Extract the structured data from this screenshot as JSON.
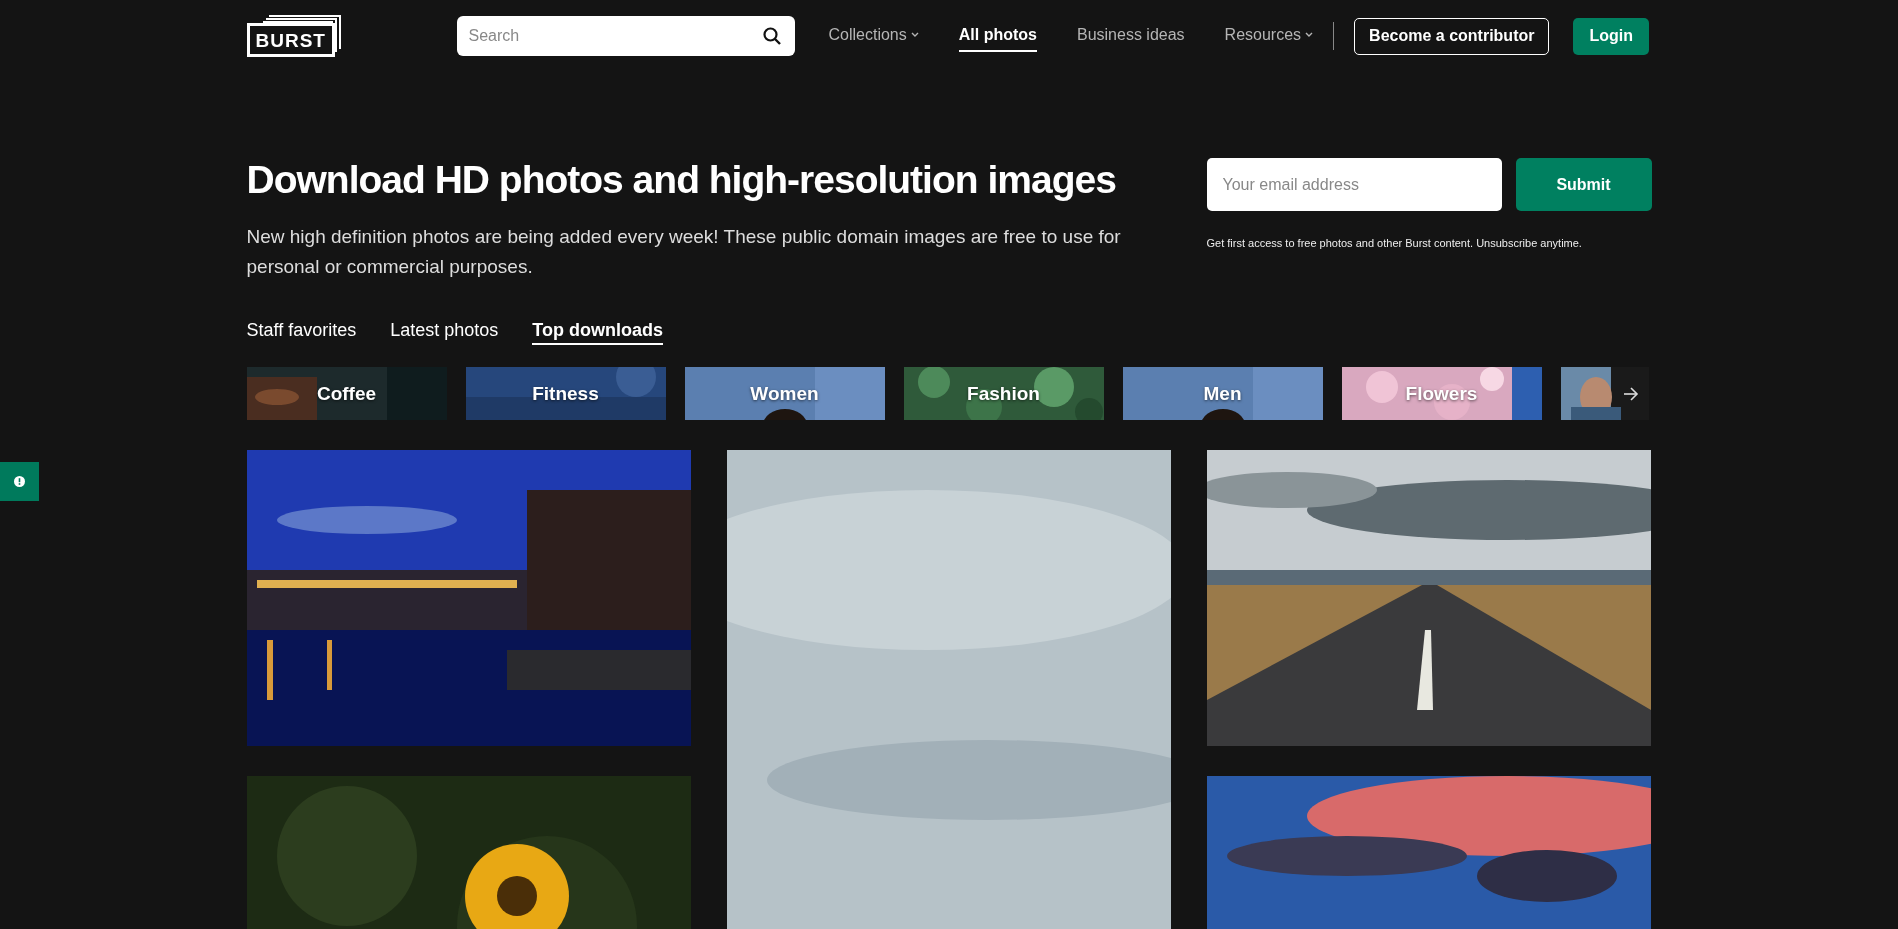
{
  "header": {
    "logo": "BURST",
    "search": {
      "placeholder": "Search"
    },
    "nav": [
      {
        "label": "Collections",
        "dropdown": true,
        "selected": false
      },
      {
        "label": "All photos",
        "dropdown": false,
        "selected": true
      },
      {
        "label": "Business ideas",
        "dropdown": false,
        "selected": false
      },
      {
        "label": "Resources",
        "dropdown": true,
        "selected": false
      }
    ],
    "contributor_button": "Become a contributor",
    "login_button": "Login"
  },
  "hero": {
    "title": "Download HD photos and high-resolution images",
    "description": "New high definition photos are being added every week! These public domain images are free to use for personal or commercial purposes.",
    "email": {
      "placeholder": "Your email address"
    },
    "submit_button": "Submit",
    "note": "Get first access to free photos and other Burst content. Unsubscribe anytime."
  },
  "tabs": [
    {
      "label": "Staff favorites",
      "selected": false
    },
    {
      "label": "Latest photos",
      "selected": false
    },
    {
      "label": "Top downloads",
      "selected": true
    }
  ],
  "categories": [
    {
      "label": "Coffee"
    },
    {
      "label": "Fitness",
      "kind": "plain"
    },
    {
      "label": "Women"
    },
    {
      "label": "Fashion",
      "kind": "leaves"
    },
    {
      "label": "Men"
    },
    {
      "label": "Flowers",
      "kind": "flowers"
    }
  ],
  "photo_columns": [
    [
      {
        "kind": "city"
      },
      {
        "kind": "flower"
      }
    ],
    [
      {
        "kind": "sea"
      }
    ],
    [
      {
        "kind": "road"
      },
      {
        "kind": "sunset"
      }
    ]
  ]
}
